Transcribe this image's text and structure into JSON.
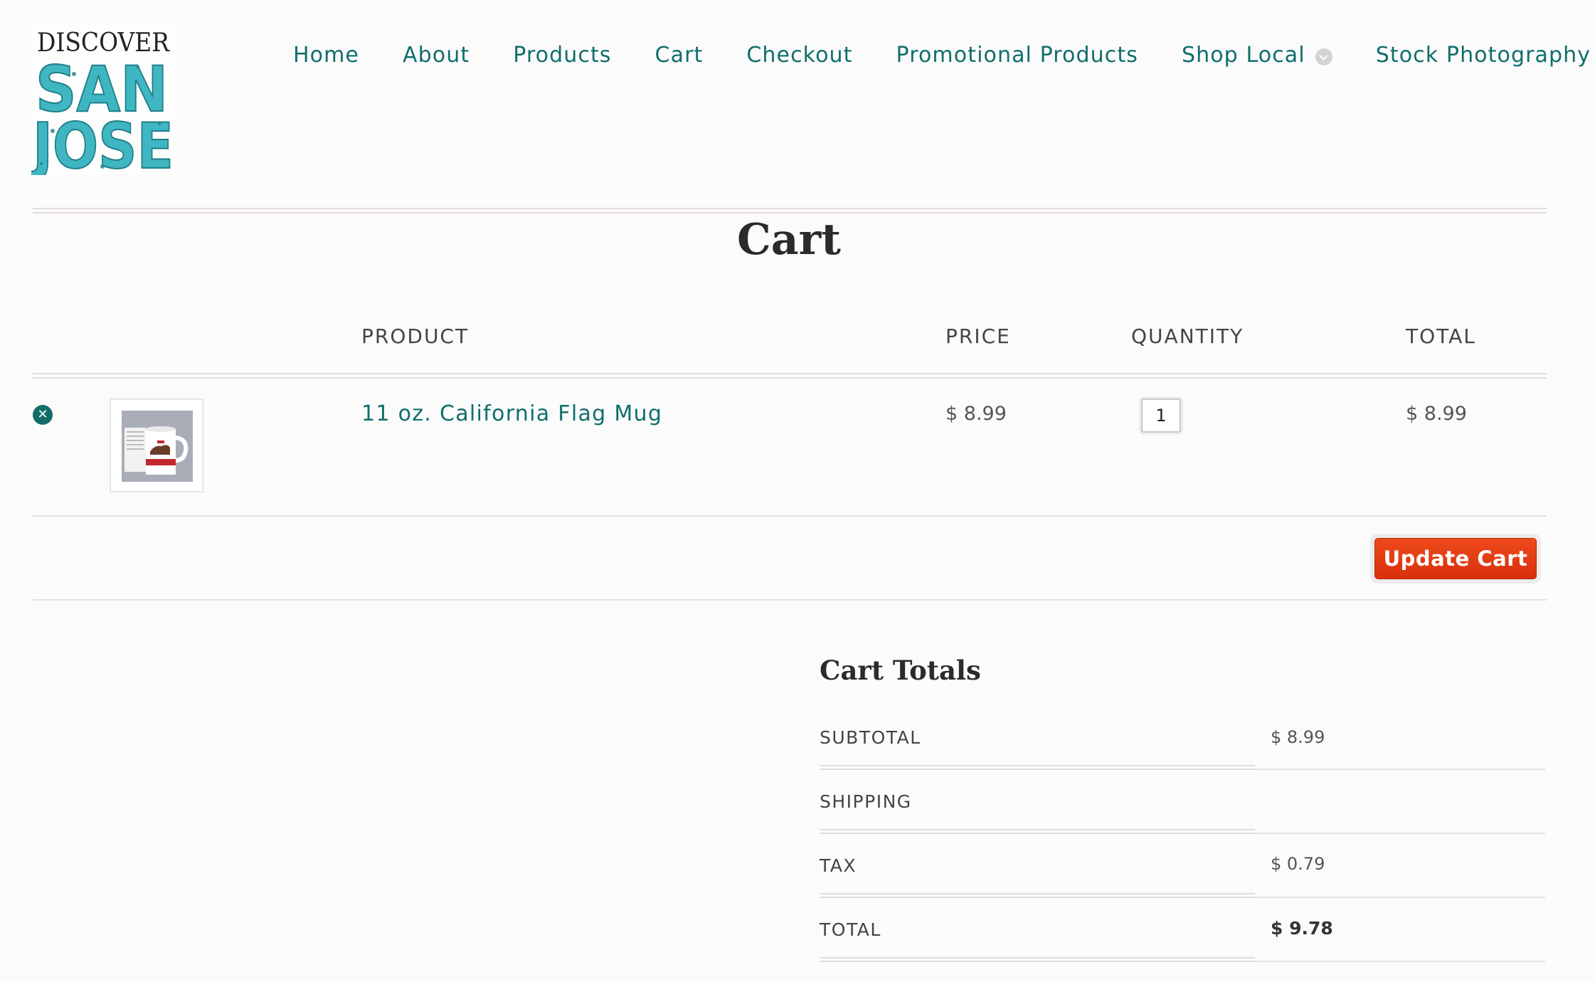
{
  "logo": {
    "line1": "DISCOVER",
    "line2": "SAN",
    "line3": "JOSE"
  },
  "nav": {
    "items": [
      {
        "label": "Home"
      },
      {
        "label": "About"
      },
      {
        "label": "Products"
      },
      {
        "label": "Cart"
      },
      {
        "label": "Checkout"
      },
      {
        "label": "Promotional Products"
      },
      {
        "label": "Shop Local"
      },
      {
        "label": "Stock Photography"
      }
    ],
    "dropdown_icon": "chevron-down-icon"
  },
  "page": {
    "title": "Cart"
  },
  "cart_table": {
    "headers": {
      "product": "PRODUCT",
      "price": "PRICE",
      "quantity": "QUANTITY",
      "total": "TOTAL"
    },
    "rows": [
      {
        "remove_icon": "close-icon",
        "product_name": "11 oz. California Flag Mug",
        "price": "$ 8.99",
        "quantity": "1",
        "total": "$ 8.99"
      }
    ],
    "update_label": "Update Cart"
  },
  "cart_totals": {
    "title": "Cart Totals",
    "rows": [
      {
        "label": "SUBTOTAL",
        "value": "$ 8.99"
      },
      {
        "label": "SHIPPING",
        "value": ""
      },
      {
        "label": "TAX",
        "value": "$ 0.79"
      },
      {
        "label": "TOTAL",
        "value": "$ 9.78"
      }
    ]
  },
  "colors": {
    "link": "#0f6e6b",
    "logo_teal": "#3fb6c2",
    "button": "#e03a12",
    "background": "#fbfbfb"
  }
}
